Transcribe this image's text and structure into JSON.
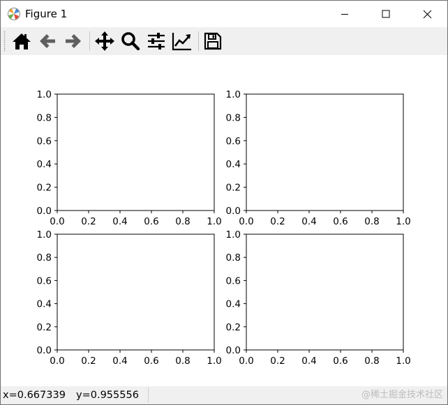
{
  "window": {
    "title": "Figure 1"
  },
  "toolbar": {
    "buttons": [
      {
        "name": "home",
        "icon": "home-icon"
      },
      {
        "name": "back",
        "icon": "arrow-left-icon"
      },
      {
        "name": "forward",
        "icon": "arrow-right-icon"
      },
      {
        "name": "pan",
        "icon": "move-arrows-icon"
      },
      {
        "name": "zoom",
        "icon": "magnifier-icon"
      },
      {
        "name": "subplots",
        "icon": "sliders-icon"
      },
      {
        "name": "customize",
        "icon": "chart-line-icon"
      },
      {
        "name": "save",
        "icon": "floppy-disk-icon"
      }
    ]
  },
  "chart_data": [
    {
      "type": "line",
      "subplot": "top-left",
      "xlim": [
        0.0,
        1.0
      ],
      "ylim": [
        0.0,
        1.0
      ],
      "xticks": [
        "0.0",
        "0.2",
        "0.4",
        "0.6",
        "0.8",
        "1.0"
      ],
      "yticks": [
        "0.0",
        "0.2",
        "0.4",
        "0.6",
        "0.8",
        "1.0"
      ],
      "series": []
    },
    {
      "type": "line",
      "subplot": "top-right",
      "xlim": [
        0.0,
        1.0
      ],
      "ylim": [
        0.0,
        1.0
      ],
      "xticks": [
        "0.0",
        "0.2",
        "0.4",
        "0.6",
        "0.8",
        "1.0"
      ],
      "yticks": [
        "0.0",
        "0.2",
        "0.4",
        "0.6",
        "0.8",
        "1.0"
      ],
      "series": []
    },
    {
      "type": "line",
      "subplot": "bottom-left",
      "xlim": [
        0.0,
        1.0
      ],
      "ylim": [
        0.0,
        1.0
      ],
      "xticks": [
        "0.0",
        "0.2",
        "0.4",
        "0.6",
        "0.8",
        "1.0"
      ],
      "yticks": [
        "0.0",
        "0.2",
        "0.4",
        "0.6",
        "0.8",
        "1.0"
      ],
      "series": []
    },
    {
      "type": "line",
      "subplot": "bottom-right",
      "xlim": [
        0.0,
        1.0
      ],
      "ylim": [
        0.0,
        1.0
      ],
      "xticks": [
        "0.0",
        "0.2",
        "0.4",
        "0.6",
        "0.8",
        "1.0"
      ],
      "yticks": [
        "0.0",
        "0.2",
        "0.4",
        "0.6",
        "0.8",
        "1.0"
      ],
      "series": []
    }
  ],
  "status": {
    "x_readout": "x=0.667339",
    "y_readout": "y=0.955556",
    "watermark": "@稀土掘金技术社区"
  }
}
